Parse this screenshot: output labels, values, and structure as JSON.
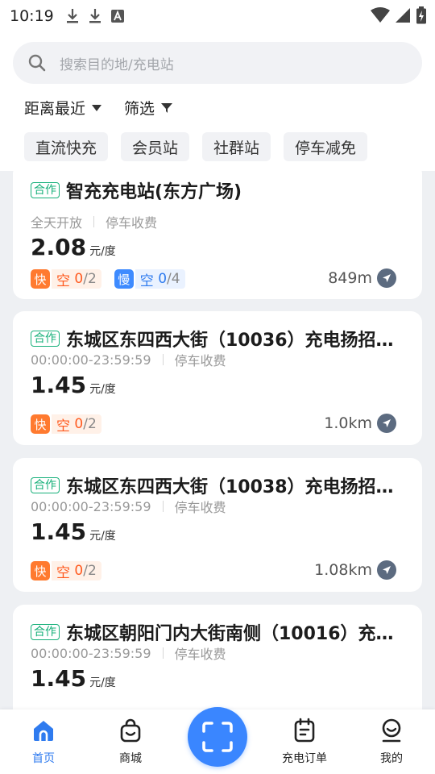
{
  "status_bar": {
    "time": "10:19"
  },
  "search": {
    "placeholder": "搜索目的地/充电站"
  },
  "filters": {
    "sort_label": "距离最近",
    "filter_label": "筛选"
  },
  "tags": [
    "直流快充",
    "会员站",
    "社群站",
    "停车减免"
  ],
  "stations": [
    {
      "badge": "合作",
      "name": "智充充电站(东方广场)",
      "hours": "全天开放",
      "parking": "停车收费",
      "price": "2.08",
      "price_unit": "元/度",
      "fast": {
        "type": "快",
        "label": "空",
        "free": "0",
        "total": "/2"
      },
      "slow": {
        "type": "慢",
        "label": "空",
        "free": "0",
        "total": "/4"
      },
      "distance": "849m"
    },
    {
      "badge": "合作",
      "name": "东城区东四西大街（10036）充电扬招…",
      "hours": "00:00:00-23:59:59",
      "parking": "停车收费",
      "price": "1.45",
      "price_unit": "元/度",
      "fast": {
        "type": "快",
        "label": "空",
        "free": "0",
        "total": "/2"
      },
      "distance": "1.0km"
    },
    {
      "badge": "合作",
      "name": "东城区东四西大街（10038）充电扬招…",
      "hours": "00:00:00-23:59:59",
      "parking": "停车收费",
      "price": "1.45",
      "price_unit": "元/度",
      "fast": {
        "type": "快",
        "label": "空",
        "free": "0",
        "total": "/2"
      },
      "distance": "1.08km"
    },
    {
      "badge": "合作",
      "name": "东城区朝阳门内大街南侧（10016）充…",
      "hours": "00:00:00-23:59:59",
      "parking": "停车收费",
      "price": "1.45",
      "price_unit": "元/度"
    }
  ],
  "bottom_nav": {
    "home": "首页",
    "mall": "商城",
    "orders": "充电订单",
    "mine": "我的"
  },
  "colors": {
    "accent": "#2f7bef",
    "fast": "#ff7a2f",
    "slow": "#3e8bff",
    "badge": "#17b07a"
  },
  "icons": [
    "download-icon",
    "download-icon",
    "font-icon",
    "wifi-icon",
    "signal-icon",
    "battery-icon",
    "search-icon",
    "navigation-icon",
    "home-icon",
    "shopping-bag-icon",
    "scan-icon",
    "order-icon",
    "profile-icon"
  ]
}
